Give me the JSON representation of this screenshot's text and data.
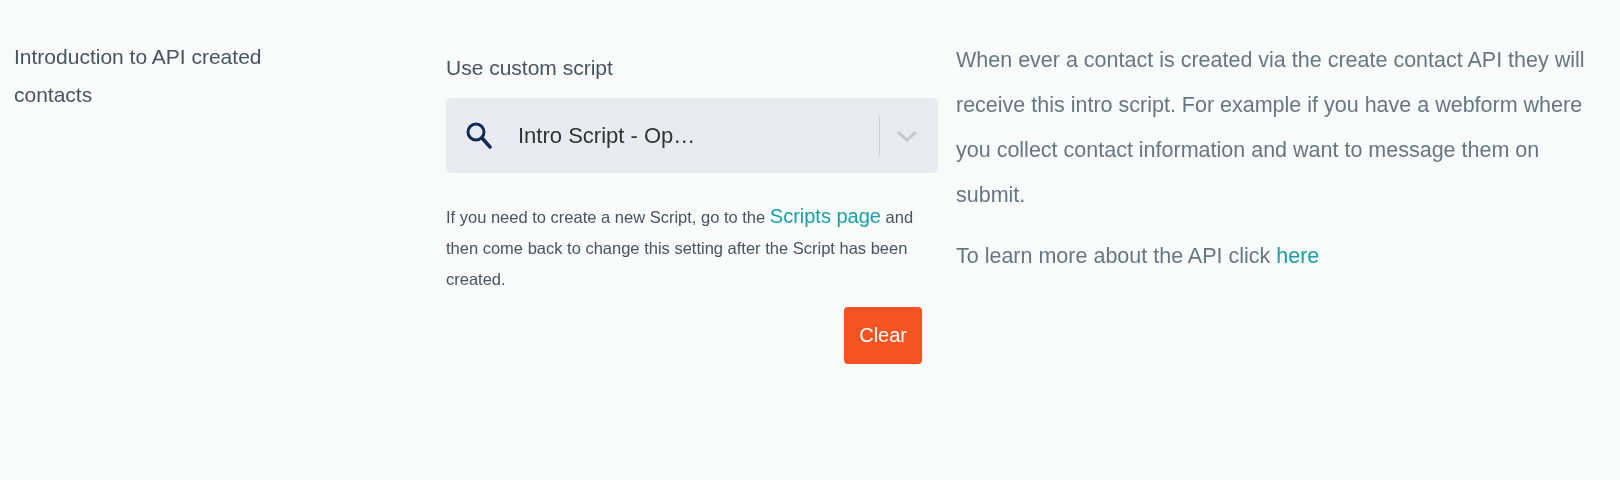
{
  "setting": {
    "title": "Introduction to API created contacts"
  },
  "custom_script": {
    "label": "Use custom script",
    "value": "Intro Script - Op…",
    "help": {
      "before": "If you need to create a new Script, go to the",
      "link": "Scripts page",
      "after": "and then come back to change this setting after the Script has been created."
    },
    "clear_button": "Clear"
  },
  "description": {
    "paragraph": "When ever a contact is created via the create contact API they will receive this intro script. For example if you have a webform where you collect contact information and want to message them on submit.",
    "learn_more": {
      "text": "To learn more about the API click",
      "link": "here"
    }
  }
}
